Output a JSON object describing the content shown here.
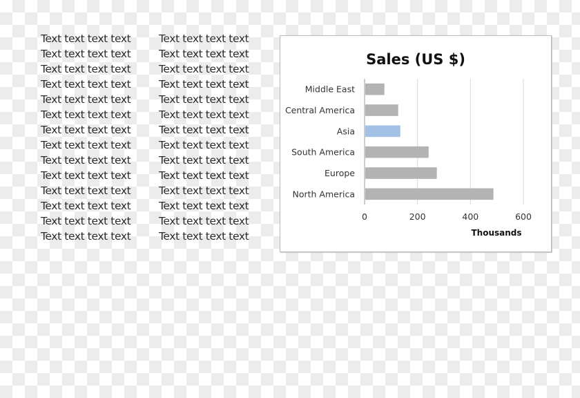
{
  "text_block": {
    "left_column": [
      "Text text text text",
      "Text text text text",
      "Text text text text",
      "Text text text text",
      "Text text text text",
      "Text text text text",
      "Text text text text",
      "Text text text text",
      "Text text text text",
      "Text text text text",
      "Text text text text",
      "Text text text text",
      "Text text text text",
      "Text text text text"
    ],
    "right_column": [
      "Text text text text",
      "Text text text text",
      "Text text text text",
      "Text text text text",
      "Text text text text",
      "Text text text text",
      "Text text text text",
      "Text text text text",
      "Text text text text",
      "Text text text text",
      "Text text text text",
      "Text text text text",
      "Text text text text",
      "Text text text text"
    ]
  },
  "chart_data": {
    "type": "bar",
    "orientation": "horizontal",
    "title": "Sales (US $)",
    "categories": [
      "North America",
      "Europe",
      "South America",
      "Asia",
      "Central America",
      "Middle East"
    ],
    "values": [
      487,
      273,
      242,
      135,
      127,
      75
    ],
    "highlight_category": "Asia",
    "xlabel": "Thousands",
    "ylabel": "",
    "xlim": [
      0,
      600
    ],
    "xticks": [
      0,
      200,
      400,
      600
    ],
    "grid": true,
    "legend": "none",
    "colors": {
      "bar": "#b3b3b3",
      "highlight": "#a3c1e4",
      "grid": "#d9d9d9"
    }
  }
}
